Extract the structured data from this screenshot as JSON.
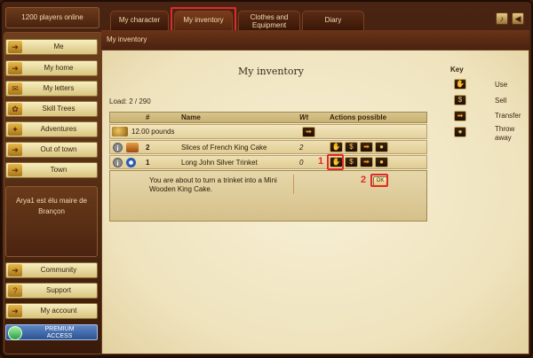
{
  "header": {
    "players_online": "1200 players online",
    "tabs": [
      {
        "label": "My character"
      },
      {
        "label": "My inventory"
      },
      {
        "label": "Clothes and Equipment"
      },
      {
        "label": "Diary"
      }
    ],
    "icons": [
      "music-note-icon",
      "speaker-icon"
    ]
  },
  "sidebar": {
    "items": [
      {
        "label": "Me"
      },
      {
        "label": "My home"
      },
      {
        "label": "My letters"
      },
      {
        "label": "Skill Trees"
      },
      {
        "label": "Adventures"
      },
      {
        "label": "Out of town"
      },
      {
        "label": "Town"
      }
    ],
    "news": "Arya1 est élu maire de Brançon",
    "bottom_items": [
      {
        "label": "Community"
      },
      {
        "label": "Support"
      },
      {
        "label": "My account"
      }
    ],
    "premium": "PREMIUM ACCESS"
  },
  "breadcrumb": "My inventory",
  "inventory": {
    "title": "My inventory",
    "load": "Load: 2 / 290",
    "columns": {
      "num": "#",
      "name": "Name",
      "wt": "Wt",
      "actions": "Actions possible"
    },
    "pounds": "12.00 pounds",
    "rows": [
      {
        "num": "2",
        "name": "Slices of French King Cake",
        "wt": "2"
      },
      {
        "num": "1",
        "name": "Long John Silver Trinket",
        "wt": "0"
      }
    ],
    "confirm_message": "You are about to turn a trinket into a Mini Wooden King Cake.",
    "ok_label": "OK",
    "markers": [
      "1",
      "2"
    ]
  },
  "key": {
    "title": "Key",
    "items": [
      {
        "label": "Use"
      },
      {
        "label": "Sell"
      },
      {
        "label": "Transfer"
      },
      {
        "label": "Throw away"
      }
    ]
  },
  "colors": {
    "highlight": "#e02a2a",
    "parchment": "#f3e8c6",
    "wood": "#4a2412"
  }
}
